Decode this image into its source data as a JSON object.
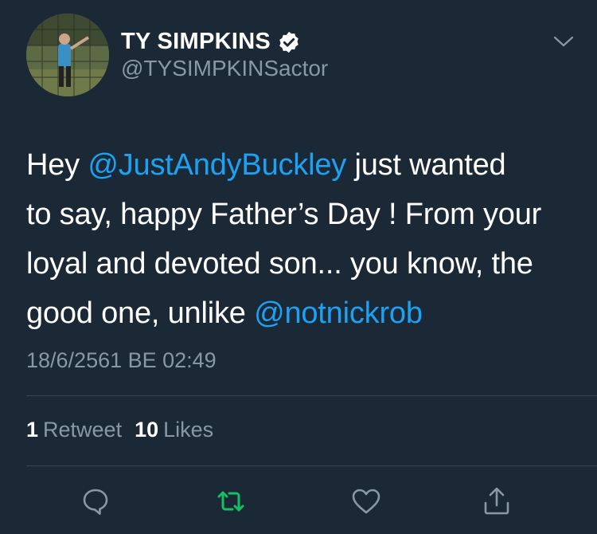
{
  "author": {
    "display_name": "TY SIMPKINS",
    "handle": "@TYSIMPKINSactor",
    "verified": true
  },
  "tweet": {
    "lines": [
      [
        {
          "text": "Hey ",
          "type": "text"
        },
        {
          "text": "@JustAndyBuckley",
          "type": "mention"
        },
        {
          "text": " just wanted",
          "type": "text"
        }
      ],
      [
        {
          "text": "to say, happy Father’s Day ! From your",
          "type": "text"
        }
      ],
      [
        {
          "text": "loyal and devoted son... you know, the",
          "type": "text"
        }
      ],
      [
        {
          "text": "good one, unlike ",
          "type": "text"
        },
        {
          "text": "@notnickrob",
          "type": "mention"
        }
      ]
    ],
    "timestamp": "18/6/2561 BE 02:49"
  },
  "stats": {
    "retweets_count": "1",
    "retweets_label": "Retweet",
    "likes_count": "10",
    "likes_label": "Likes"
  },
  "actions": [
    {
      "icon": "reply-icon"
    },
    {
      "icon": "retweet-icon",
      "active": true,
      "color": "#17bf63"
    },
    {
      "icon": "like-icon"
    },
    {
      "icon": "share-icon"
    }
  ],
  "colors": {
    "background": "#1b2836",
    "mention": "#1da1f2",
    "secondary_text": "#8899a6",
    "retweet_active": "#17bf63"
  }
}
